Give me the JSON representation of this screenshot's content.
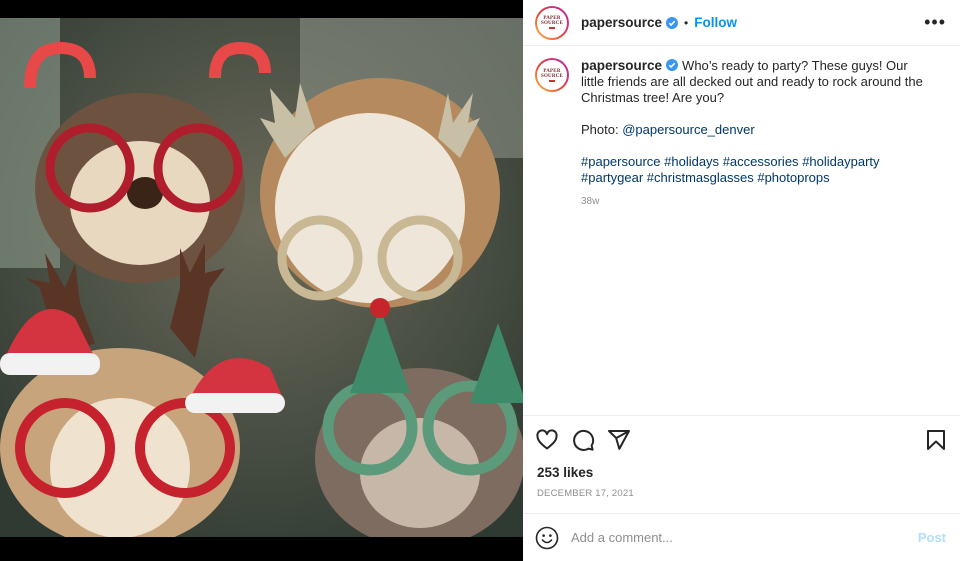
{
  "account": {
    "username": "papersource",
    "avatar_text": [
      "PAPER",
      "SOURCE"
    ]
  },
  "header": {
    "separator": "•",
    "follow_label": "Follow",
    "more_label": "•••"
  },
  "caption": {
    "text": "Who’s ready to party? These guys! Our little friends are all decked out and ready to rock around the Christmas tree! Are you?",
    "photo_prefix": "Photo: ",
    "photo_credit": "@papersource_denver",
    "hashtags": [
      "#papersource",
      "#holidays",
      "#accessories",
      "#holidayparty",
      "#partygear",
      "#christmasglasses",
      "#photoprops"
    ],
    "age": "38w"
  },
  "icons": {
    "like": "heart-icon",
    "comment": "comment-icon",
    "share": "paper-plane-icon",
    "save": "bookmark-icon",
    "verified": "verified-badge-icon",
    "emoji": "smiley-icon"
  },
  "stats": {
    "likes": "253 likes",
    "date": "December 17, 2021"
  },
  "comment_box": {
    "placeholder": "Add a comment...",
    "post_label": "Post"
  },
  "colors": {
    "accent": "#0095f6",
    "link": "#00376b",
    "muted": "#8e8e8e",
    "post_disabled": "#b2dffc"
  }
}
